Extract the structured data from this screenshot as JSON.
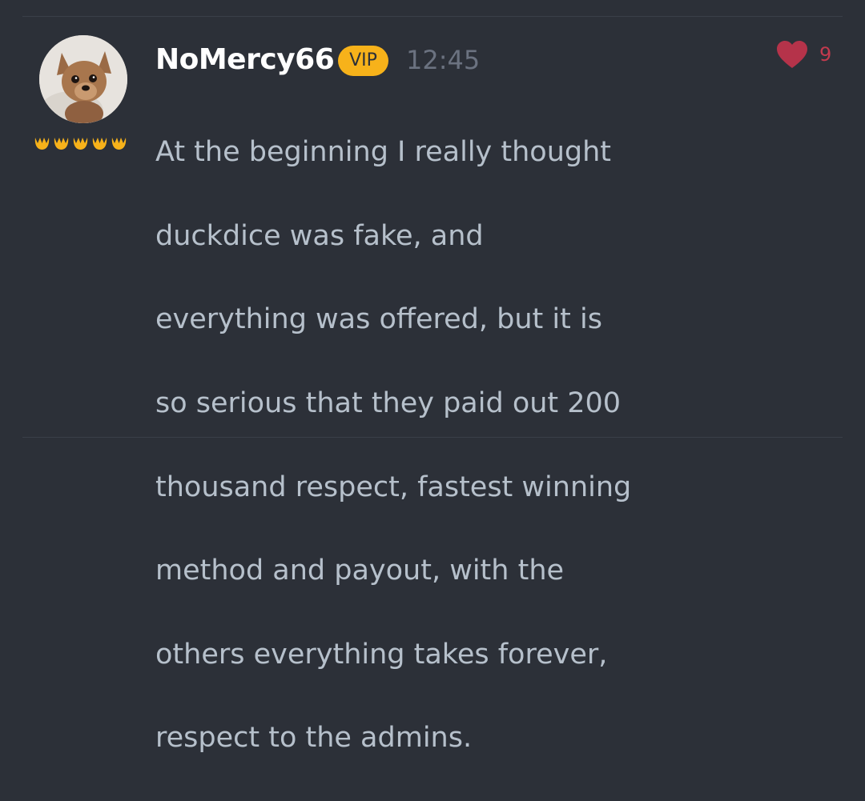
{
  "comment": {
    "username": "NoMercy66",
    "badge": "VIP",
    "time": "12:45",
    "likes": "9",
    "rank_level": 5,
    "body_lines": [
      "At the beginning I really thought",
      "duckdice was fake, and",
      "everything was offered, but it is",
      "so serious that they paid out 200",
      "thousand respect, fastest winning",
      "method and payout, with the",
      "others everything takes forever,",
      "respect to the admins."
    ]
  },
  "colors": {
    "background": "#2c3038",
    "accent": "#f7b21a",
    "heart": "#c23a4e",
    "text": "#b6c0cb",
    "muted": "#6b7280"
  },
  "icons": {
    "avatar": "dog-avatar",
    "rank": "paw-icon",
    "like": "heart-icon"
  }
}
